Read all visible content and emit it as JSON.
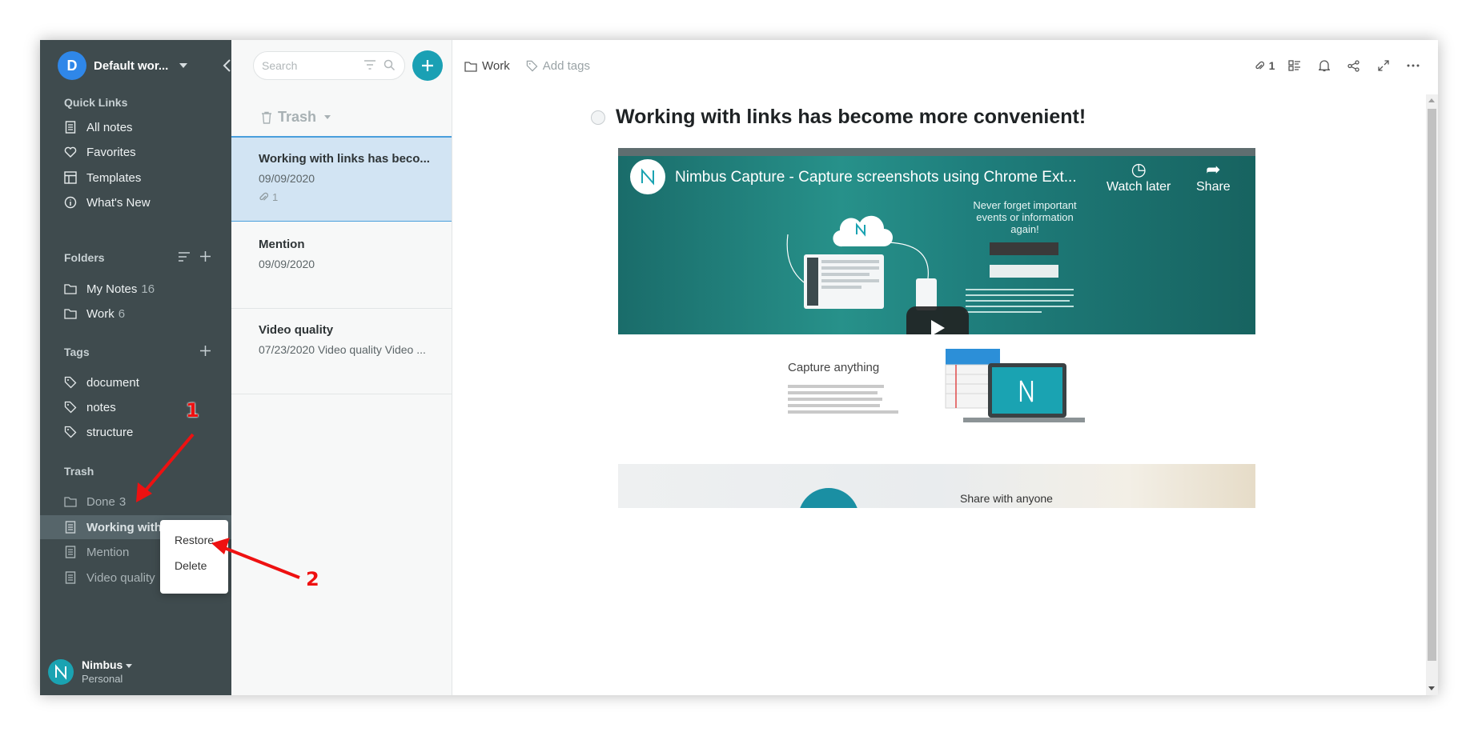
{
  "workspace": {
    "initial": "D",
    "name": "Default wor..."
  },
  "sidebar": {
    "quick_links_title": "Quick Links",
    "quick_links": [
      {
        "label": "All notes",
        "icon": "note-icon"
      },
      {
        "label": "Favorites",
        "icon": "heart-icon"
      },
      {
        "label": "Templates",
        "icon": "templates-icon"
      },
      {
        "label": "What's New",
        "icon": "info-icon"
      }
    ],
    "folders_title": "Folders",
    "folders": [
      {
        "label": "My Notes",
        "count": "16"
      },
      {
        "label": "Work",
        "count": "6"
      }
    ],
    "tags_title": "Tags",
    "tags": [
      {
        "label": "document"
      },
      {
        "label": "notes"
      },
      {
        "label": "structure"
      }
    ],
    "trash_title": "Trash",
    "trash_folder": {
      "label": "Done",
      "count": "3"
    },
    "trash_items": [
      {
        "label": "Working with"
      },
      {
        "label": "Mention"
      },
      {
        "label": "Video quality"
      }
    ]
  },
  "context_menu": {
    "restore": "Restore",
    "delete": "Delete"
  },
  "user": {
    "name": "Nimbus",
    "plan": "Personal"
  },
  "note_list": {
    "search_placeholder": "Search",
    "header": "Trash",
    "notes": [
      {
        "title": "Working with links has beco...",
        "date": "09/09/2020",
        "attachments": "1"
      },
      {
        "title": "Mention",
        "date": "09/09/2020"
      },
      {
        "title": "Video quality",
        "date": "07/23/2020 Video quality Video ..."
      }
    ]
  },
  "editor": {
    "folder": "Work",
    "add_tags": "Add tags",
    "attachments_count": "1",
    "title": "Working with links has become more convenient!",
    "video": {
      "title": "Nimbus Capture - Capture screenshots using Chrome Ext...",
      "watch_later": "Watch later",
      "share": "Share",
      "slogan": "Never forget important events or information again!"
    },
    "capture_heading": "Capture anything",
    "banner_text": "Share with anyone"
  },
  "annotations": {
    "marker_1": "1",
    "marker_2": "2"
  },
  "colors": {
    "sidebar": "#3f4b4e",
    "accent": "#1aa0b4",
    "selected_note": "#d2e4f3",
    "annotation": "#ee1111"
  }
}
